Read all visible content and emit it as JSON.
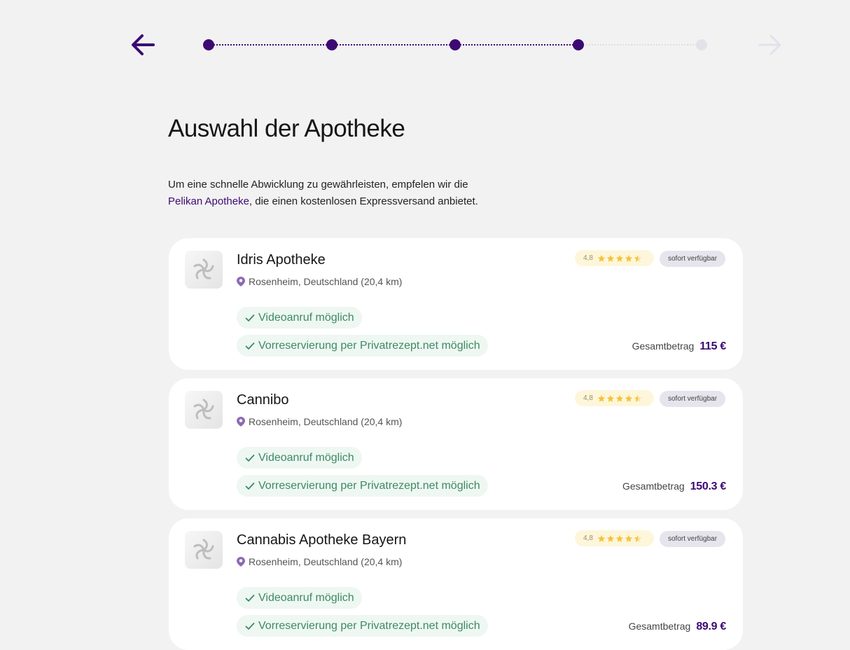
{
  "header": {
    "back_label": "Zurück",
    "steps_total": 5,
    "steps_completed": 4
  },
  "title": "Auswahl der Apotheke",
  "intro": {
    "before": "Um eine schnelle Abwicklung zu gewährleisten, empfelen wir die",
    "highlight": "Pelikan Apotheke",
    "after": ", die einen kostenlosen Expressversand anbietet."
  },
  "colors": {
    "primary": "#3d0a73",
    "feature_text": "#3d8a63",
    "feature_bg": "#eef7f2",
    "star": "#f6c33a"
  },
  "pharmacies": [
    {
      "name": "Idris Apotheke",
      "location": "Rosenheim, Deutschland (20,4 km)",
      "rating": "4,8",
      "stars": 4.5,
      "availability": "sofort verfügbar",
      "features": [
        "Videoanruf möglich",
        "Vorreservierung per Privatrezept.net möglich"
      ],
      "total_label": "Gesamtbetrag",
      "total_value": "115 €"
    },
    {
      "name": "Cannibo",
      "location": "Rosenheim, Deutschland (20,4 km)",
      "rating": "4,8",
      "stars": 4.5,
      "availability": "sofort verfügbar",
      "features": [
        "Videoanruf möglich",
        "Vorreservierung per Privatrezept.net möglich"
      ],
      "total_label": "Gesamtbetrag",
      "total_value": "150.3 €"
    },
    {
      "name": "Cannabis Apotheke Bayern",
      "location": "Rosenheim, Deutschland (20,4 km)",
      "rating": "4,8",
      "stars": 4.5,
      "availability": "sofort verfügbar",
      "features": [
        "Videoanruf möglich",
        "Vorreservierung per Privatrezept.net möglich"
      ],
      "total_label": "Gesamtbetrag",
      "total_value": "89.9 €"
    }
  ]
}
